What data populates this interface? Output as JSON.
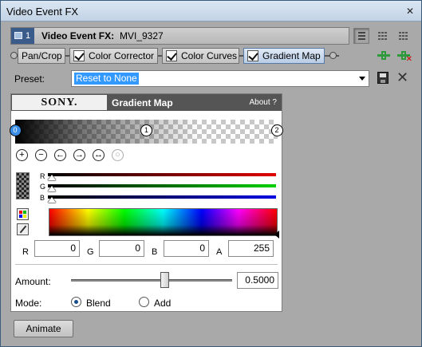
{
  "window": {
    "title": "Video Event FX",
    "close_glyph": "✕"
  },
  "fx_header": {
    "badge_number": "1",
    "label": "Video Event FX:",
    "value": "MVI_9327"
  },
  "chain": [
    {
      "label": "Pan/Crop",
      "checked": false
    },
    {
      "label": "Color Corrector",
      "checked": true
    },
    {
      "label": "Color Curves",
      "checked": true
    },
    {
      "label": "Gradient Map",
      "checked": true,
      "active": true
    }
  ],
  "preset": {
    "label": "Preset:",
    "value": "Reset to None"
  },
  "plugin": {
    "brand": "SONY.",
    "name": "Gradient Map",
    "about": "About  ?"
  },
  "gradient": {
    "stops": [
      {
        "label": "0",
        "position": 0.0,
        "selected": true
      },
      {
        "label": "1",
        "position": 0.5,
        "selected": false
      },
      {
        "label": "2",
        "position": 1.0,
        "selected": false
      }
    ]
  },
  "tools": {
    "add": "+",
    "remove": "−",
    "prev": "←",
    "next": "→",
    "distribute": "↔",
    "reset": "○"
  },
  "rgb_bars": {
    "r": "R",
    "g": "G",
    "b": "B",
    "r_value": 0,
    "g_value": 0,
    "b_value": 0
  },
  "fields": {
    "r_label": "R",
    "r_value": "0",
    "g_label": "G",
    "g_value": "0",
    "b_label": "B",
    "b_value": "0",
    "a_label": "A",
    "a_value": "255"
  },
  "amount": {
    "label": "Amount:",
    "value": "0.5000",
    "fraction": 0.5
  },
  "mode": {
    "label": "Mode:",
    "blend": "Blend",
    "add": "Add",
    "selected": "Blend"
  },
  "footer": {
    "animate": "Animate"
  },
  "colors": {
    "accent": "#3399ff",
    "header_blue": "#3b5b8a",
    "plug_green": "#2e9a3c"
  }
}
